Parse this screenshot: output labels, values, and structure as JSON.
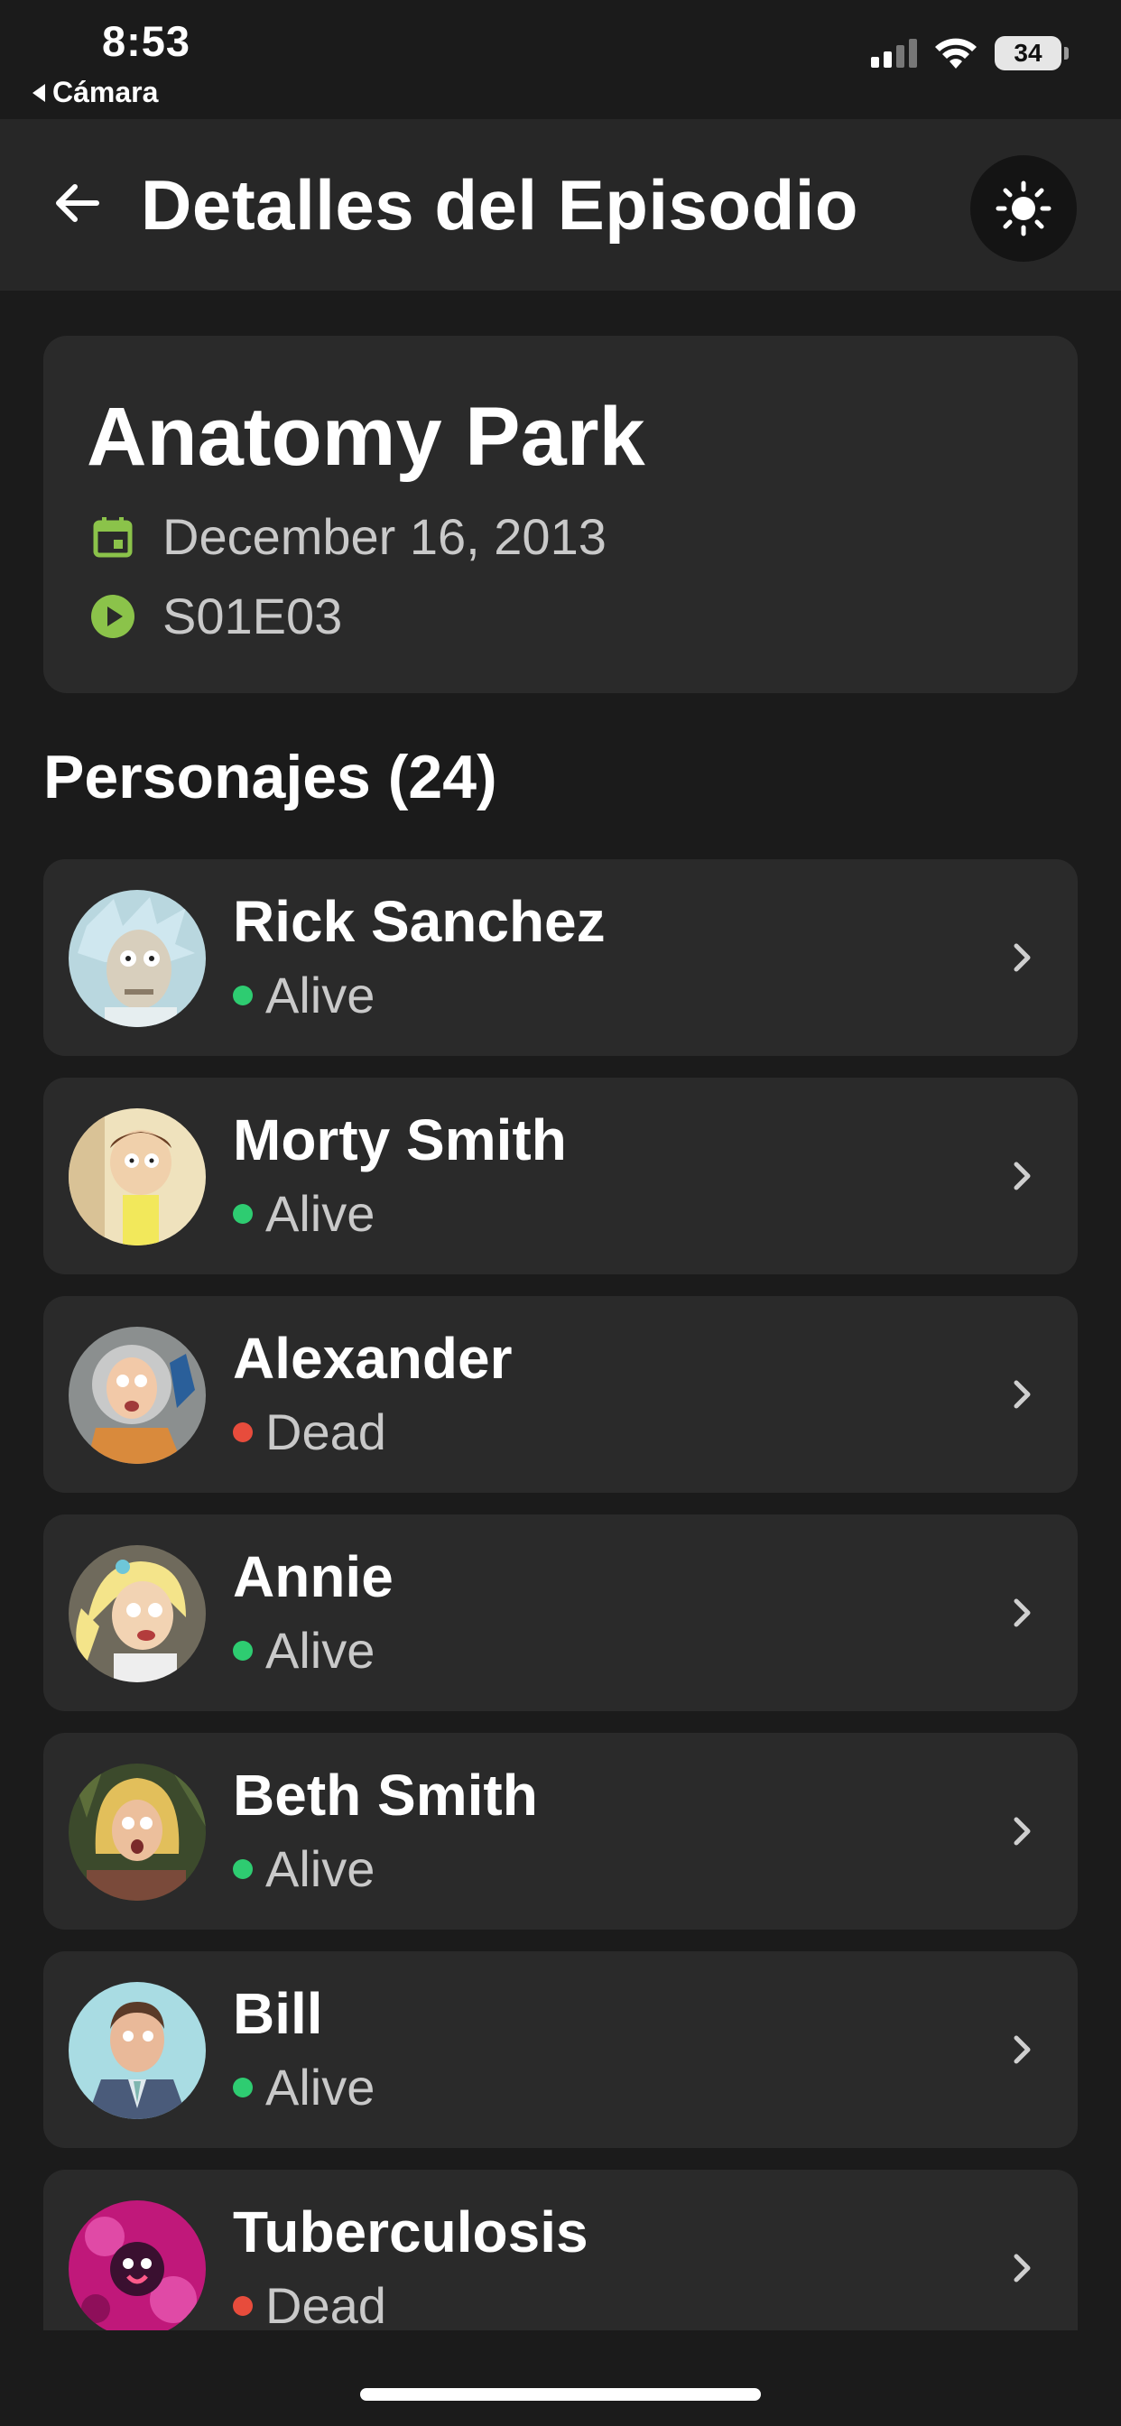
{
  "status_bar": {
    "time": "8:53",
    "back_app": "Cámara",
    "battery": "34"
  },
  "app_bar": {
    "title": "Detalles del Episodio",
    "back_icon": "arrow-left-icon",
    "theme_icon": "sun-icon"
  },
  "episode": {
    "name": "Anatomy Park",
    "air_date": "December 16, 2013",
    "code": "S01E03",
    "date_icon_color": "#8bc34a",
    "code_icon_color": "#8bc34a"
  },
  "characters_section": {
    "title": "Personajes (24)"
  },
  "colors": {
    "background": "#1b1b1b",
    "card": "#2a2a2a",
    "alive": "#2ecc71",
    "dead": "#e74c3c",
    "accent": "#8bc34a"
  },
  "characters": [
    {
      "name": "Rick Sanchez",
      "status": "Alive"
    },
    {
      "name": "Morty Smith",
      "status": "Alive"
    },
    {
      "name": "Alexander",
      "status": "Dead"
    },
    {
      "name": "Annie",
      "status": "Alive"
    },
    {
      "name": "Beth Smith",
      "status": "Alive"
    },
    {
      "name": "Bill",
      "status": "Alive"
    },
    {
      "name": "Tuberculosis",
      "status": "Dead"
    }
  ]
}
